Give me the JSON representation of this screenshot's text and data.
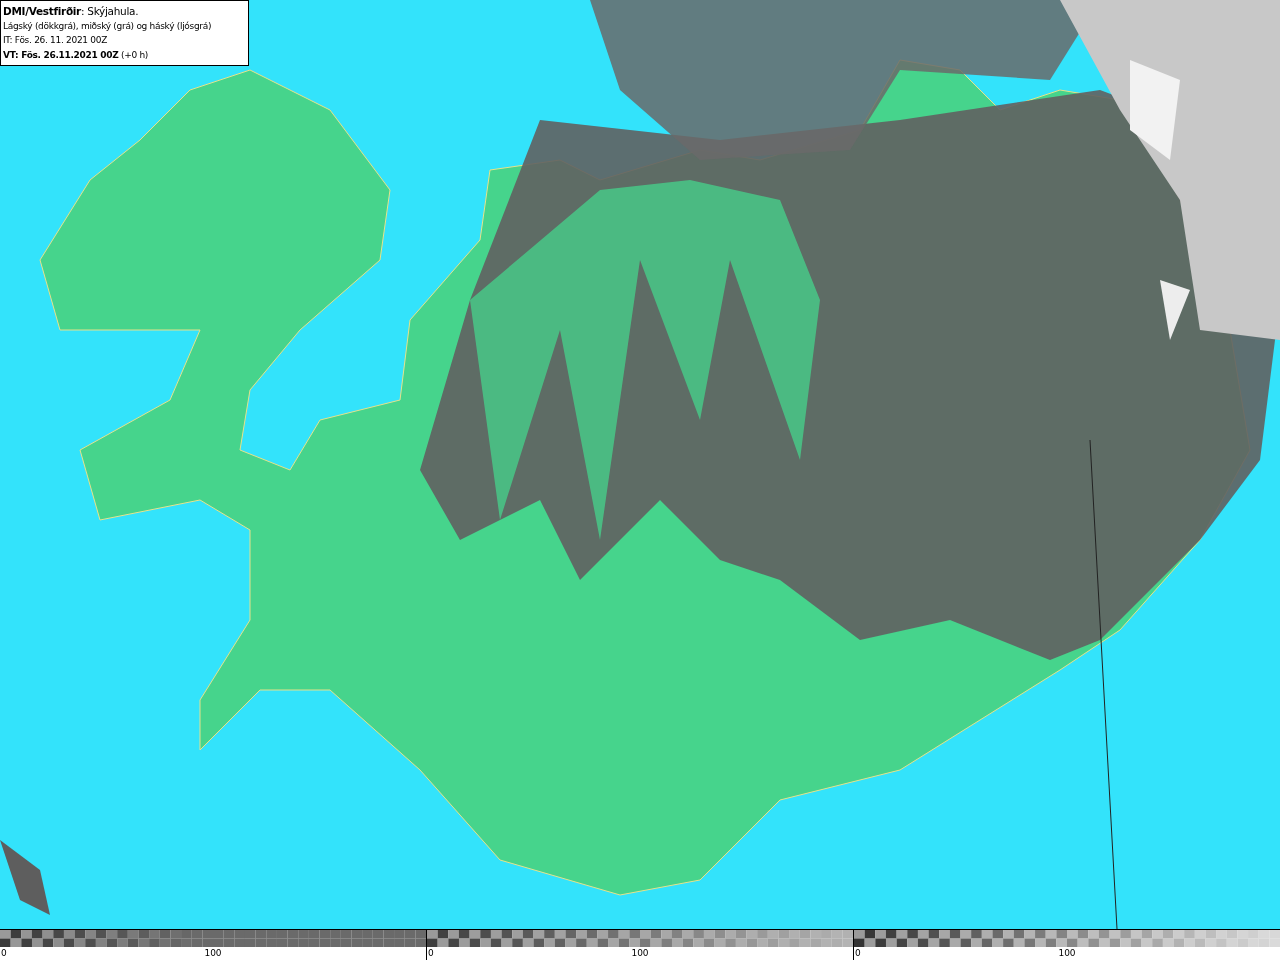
{
  "header": {
    "title": "**DMI/Vestfirðir**: Skýjahula.",
    "description": "Lágský (dökkgrá), miðský (grá) og háský (ljósgrá)",
    "issue_time": "IT: Fös. 26. 11. 2021 00Z",
    "valid_time": "**VT: Fös. 26.11.2021 00Z** (+0 h)"
  },
  "legend": [
    {
      "kind": "low",
      "ticks": [
        "0",
        "100"
      ]
    },
    {
      "kind": "mid",
      "ticks": [
        "0",
        "100"
      ]
    },
    {
      "kind": "high",
      "ticks": [
        "0",
        "100"
      ]
    }
  ]
}
